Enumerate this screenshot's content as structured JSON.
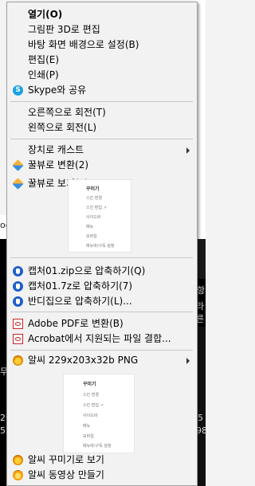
{
  "background": {
    "right_texts": [
      "항",
      "라른",
      "5",
      "98"
    ],
    "left_texts": [
      "oo",
      "무",
      "20",
      "52"
    ]
  },
  "menu": {
    "items": [
      {
        "label": "열기(O)",
        "bold": true
      },
      {
        "label": "그림판 3D로 편집"
      },
      {
        "label": "바탕 화면 배경으로 설정(B)"
      },
      {
        "label": "편집(E)"
      },
      {
        "label": "인쇄(P)"
      },
      {
        "label": "Skype와 공유",
        "icon": "skype-icon"
      },
      {
        "label": "오른쪽으로 회전(T)"
      },
      {
        "label": "왼쪽으로 회전(L)"
      },
      {
        "label": "장치로 캐스트",
        "submenu": true
      },
      {
        "label": "꿀뷰로 변환(2)",
        "icon": "honeyview-icon"
      },
      {
        "label": "꿀뷰로 보기(3)",
        "icon": "honeyview-icon"
      },
      {
        "label": "캡처01.zip으로 압축하기(Q)",
        "icon": "bandizip-icon"
      },
      {
        "label": "캡처01.7z로 압축하기(7)",
        "icon": "bandizip-icon"
      },
      {
        "label": "반디집으로 압축하기(L)...",
        "icon": "bandizip-icon"
      },
      {
        "label": "Adobe PDF로 변환(B)",
        "icon": "pdf-icon"
      },
      {
        "label": "Acrobat에서 지원되는 파일 결합...",
        "icon": "pdf-icon"
      },
      {
        "label": "알씨 229x203x32b PNG",
        "icon": "alsee-icon",
        "submenu": true
      },
      {
        "label": "알씨 꾸미기로 보기",
        "icon": "alsee-icon"
      },
      {
        "label": "알씨 동영상 만들기",
        "icon": "alsee-movie-icon"
      }
    ],
    "thumbnail": {
      "title": "꾸미기",
      "lines": [
        "스킨 변경",
        "스킨 편집 ↗",
        "사이드바",
        "메뉴",
        "모바일",
        "메뉴바/구독 설정"
      ]
    }
  },
  "colors": {
    "menu_bg": "#f2f2f2",
    "separator": "#c8c8c8",
    "border": "#a0a0a0"
  }
}
